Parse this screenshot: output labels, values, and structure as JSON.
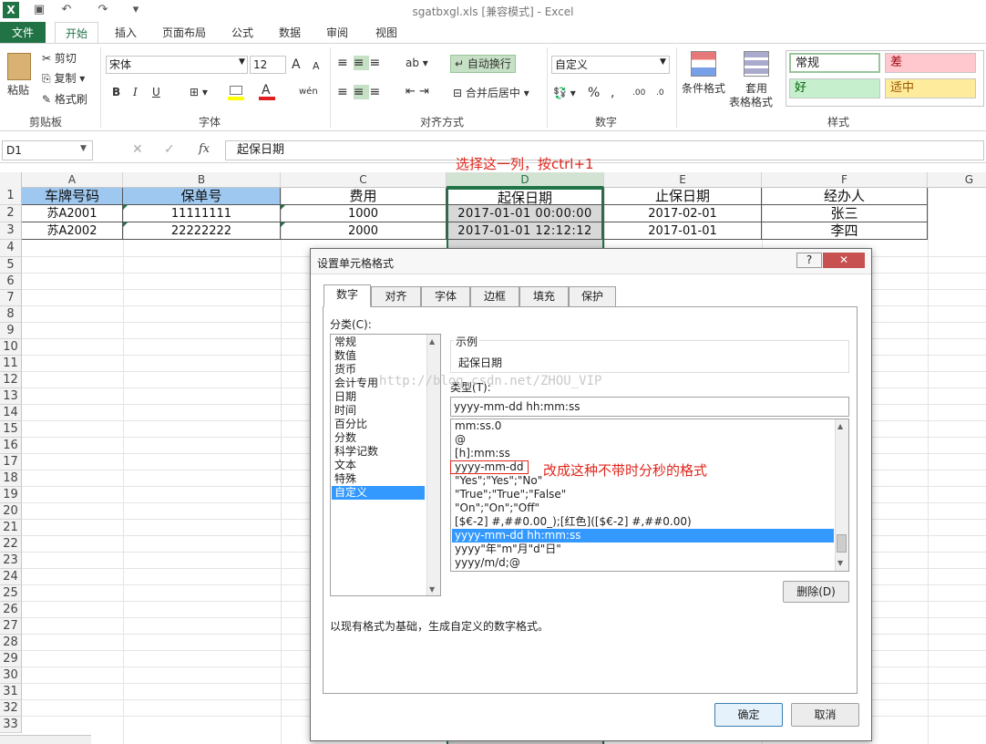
{
  "window": {
    "title": "sgatbxgl.xls  [兼容模式] - Excel"
  },
  "quick_access": {
    "undo": "↶",
    "redo": "↷"
  },
  "ribbon_tabs": [
    "文件",
    "开始",
    "插入",
    "页面布局",
    "公式",
    "数据",
    "审阅",
    "视图"
  ],
  "clipboard": {
    "paste": "粘贴",
    "cut": "剪切",
    "copy": "复制",
    "format_painter": "格式刷",
    "group": "剪贴板"
  },
  "font": {
    "name": "宋体",
    "size": "12",
    "group": "字体",
    "bold": "B",
    "italic": "I",
    "underline": "U",
    "grow": "A",
    "shrink": "A",
    "font_color": "A",
    "phonetic": "wén"
  },
  "alignment": {
    "wrap": "自动换行",
    "merge": "合并后居中",
    "group": "对齐方式"
  },
  "number": {
    "format": "自定义",
    "group": "数字",
    "percent": "%",
    "comma": ",",
    "inc_decimal": ".00",
    "dec_decimal": ".0"
  },
  "styles": {
    "cond": "条件格式",
    "table1": "套用",
    "table2": "表格格式",
    "normal": "常规",
    "bad": "差",
    "good": "好",
    "neutral": "适中",
    "group": "样式"
  },
  "formula_bar": {
    "name_box": "D1",
    "content": "起保日期",
    "cancel": "✕",
    "enter": "✓",
    "fx": "fx"
  },
  "columns": [
    "A",
    "B",
    "C",
    "D",
    "E",
    "F",
    "G"
  ],
  "rows": [
    "1",
    "2",
    "3",
    "4",
    "5",
    "6",
    "7",
    "8",
    "9",
    "10",
    "11",
    "12",
    "13",
    "14",
    "15",
    "16",
    "17",
    "18",
    "19",
    "20",
    "21",
    "22",
    "23",
    "24",
    "25",
    "26",
    "27",
    "28",
    "29",
    "30",
    "31",
    "32",
    "33"
  ],
  "sheet": [
    [
      "车牌号码",
      "保单号",
      "费用",
      "起保日期",
      "止保日期",
      "经办人"
    ],
    [
      "苏A2001",
      "11111111",
      "1000",
      "2017-01-01 00:00:00",
      "2017-02-01",
      "张三"
    ],
    [
      "苏A2002",
      "22222222",
      "2000",
      "2017-01-01 12:12:12",
      "2017-01-01",
      "李四"
    ]
  ],
  "annotations": {
    "select_col": "选择这一列，按ctrl+1",
    "change_fmt": "改成这种不带时分秒的格式"
  },
  "dialog": {
    "title": "设置单元格格式",
    "help": "?",
    "close": "✕",
    "tabs": [
      "数字",
      "对齐",
      "字体",
      "边框",
      "填充",
      "保护"
    ],
    "category_label": "分类(C):",
    "categories": [
      "常规",
      "数值",
      "货币",
      "会计专用",
      "日期",
      "时间",
      "百分比",
      "分数",
      "科学记数",
      "文本",
      "特殊",
      "自定义"
    ],
    "sample_label": "示例",
    "sample_value": "起保日期",
    "type_label": "类型(T):",
    "type_value": "yyyy-mm-dd hh:mm:ss",
    "watermark": "http://blog.csdn.net/ZHOU_VIP",
    "formats": [
      "mm:ss.0",
      "@",
      "[h]:mm:ss",
      "yyyy-mm-dd",
      "\"Yes\";\"Yes\";\"No\"",
      "\"True\";\"True\";\"False\"",
      "\"On\";\"On\";\"Off\"",
      "[$€-2] #,##0.00_);[红色]([$€-2] #,##0.00)",
      "yyyy-mm-dd hh:mm:ss",
      "yyyy\"年\"m\"月\"d\"日\"",
      "yyyy/m/d;@"
    ],
    "delete": "删除(D)",
    "description": "以现有格式为基础，生成自定义的数字格式。",
    "ok": "确定",
    "cancel": "取消"
  },
  "colors": {
    "excel_green": "#217346",
    "selection": "#3399ff",
    "header_blue": "#9fc8f0",
    "annotation_red": "#e0261c"
  }
}
